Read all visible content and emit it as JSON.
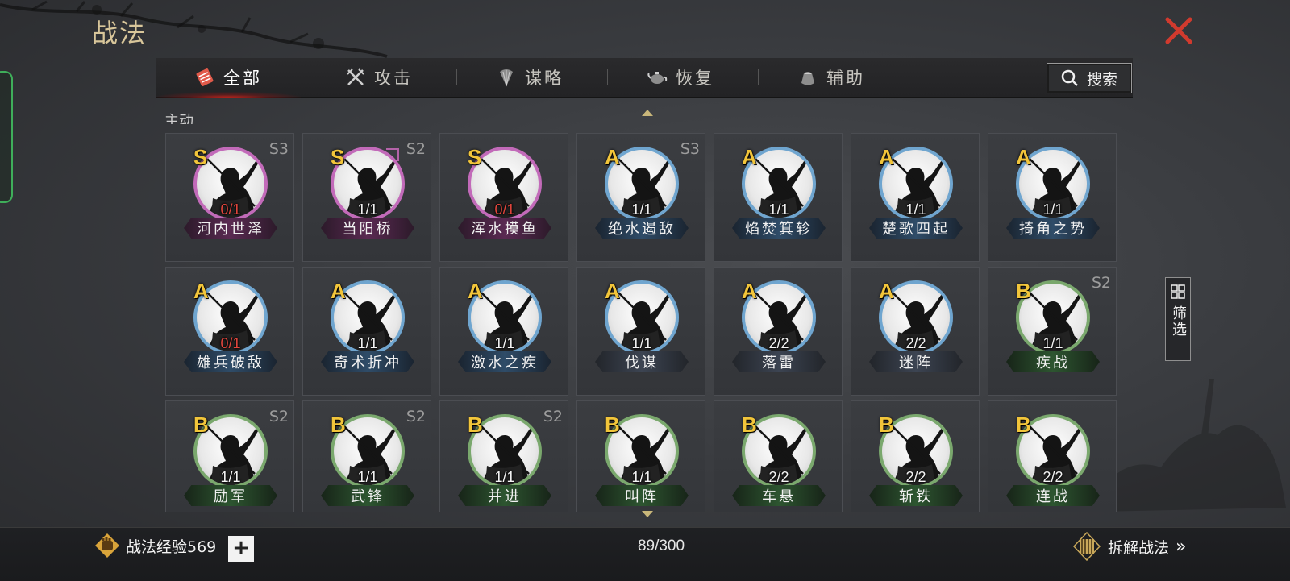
{
  "header": {
    "title": "战法",
    "close_icon": "close-x-icon"
  },
  "tabs": [
    {
      "label": "全部",
      "icon": "scroll-icon",
      "active": true
    },
    {
      "label": "攻击",
      "icon": "crossed-swords-icon",
      "active": false
    },
    {
      "label": "谋略",
      "icon": "feather-fan-icon",
      "active": false
    },
    {
      "label": "恢复",
      "icon": "teapot-icon",
      "active": false
    },
    {
      "label": "辅助",
      "icon": "pouch-icon",
      "active": false
    }
  ],
  "search": {
    "label": "搜索",
    "icon": "search-icon"
  },
  "section": {
    "label": "主动"
  },
  "skills": [
    {
      "grade": "S",
      "season": "S3",
      "count": "0/1",
      "name": "河内世泽"
    },
    {
      "grade": "S",
      "season": "S2",
      "count": "1/1",
      "name": "当阳桥"
    },
    {
      "grade": "S",
      "season": "",
      "count": "0/1",
      "name": "浑水摸鱼"
    },
    {
      "grade": "A",
      "season": "S3",
      "count": "1/1",
      "name": "绝水遏敌"
    },
    {
      "grade": "A",
      "season": "",
      "count": "1/1",
      "name": "焰焚箕轸"
    },
    {
      "grade": "A",
      "season": "",
      "count": "1/1",
      "name": "楚歌四起"
    },
    {
      "grade": "A",
      "season": "",
      "count": "1/1",
      "name": "掎角之势"
    },
    {
      "grade": "A",
      "season": "",
      "count": "0/1",
      "name": "雄兵破敌"
    },
    {
      "grade": "A",
      "season": "",
      "count": "1/1",
      "name": "奇术折冲"
    },
    {
      "grade": "A",
      "season": "",
      "count": "1/1",
      "name": "激水之疾"
    },
    {
      "grade": "A",
      "season": "",
      "count": "1/1",
      "name": "伐谋"
    },
    {
      "grade": "A",
      "season": "",
      "count": "2/2",
      "name": "落雷"
    },
    {
      "grade": "A",
      "season": "",
      "count": "2/2",
      "name": "迷阵"
    },
    {
      "grade": "B",
      "season": "S2",
      "count": "1/1",
      "name": "疾战"
    },
    {
      "grade": "B",
      "season": "S2",
      "count": "1/1",
      "name": "励军"
    },
    {
      "grade": "B",
      "season": "S2",
      "count": "1/1",
      "name": "武锋"
    },
    {
      "grade": "B",
      "season": "S2",
      "count": "1/1",
      "name": "并进"
    },
    {
      "grade": "B",
      "season": "",
      "count": "1/1",
      "name": "叫阵"
    },
    {
      "grade": "B",
      "season": "",
      "count": "2/2",
      "name": "车悬"
    },
    {
      "grade": "B",
      "season": "",
      "count": "2/2",
      "name": "斩铁"
    },
    {
      "grade": "B",
      "season": "",
      "count": "2/2",
      "name": "连战"
    }
  ],
  "filter": {
    "label": "筛选",
    "icon": "grid-icon"
  },
  "footer": {
    "exp_label": "战法经验569",
    "plus_label": "+",
    "capacity": "89/300",
    "decompose_label": "拆解战法",
    "decompose_arrow": "»"
  },
  "colors": {
    "accent_gold": "#f2c53a",
    "tab_highlight": "#d8281e",
    "zero_count": "#e2463d",
    "ring_s": "#c26ab9",
    "ring_a": "#6fa5cf",
    "ring_b": "#7aa86d"
  }
}
